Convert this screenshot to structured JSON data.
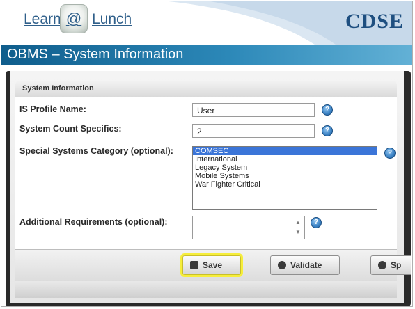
{
  "header": {
    "logo_left": "Learn",
    "logo_at": "@",
    "logo_right": "Lunch",
    "brand": "CDSE",
    "slide_title": "OBMS – System Information"
  },
  "panel": {
    "section_title": "System Information",
    "fields": {
      "profile_name_label": "IS Profile Name:",
      "profile_name_value": "User",
      "count_label": "System Count Specifics:",
      "count_value": "2",
      "category_label": "Special Systems Category (optional):",
      "category_options": [
        "COMSEC",
        "International",
        "Legacy System",
        "Mobile Systems",
        "War Fighter Critical"
      ],
      "category_selected": "COMSEC",
      "additional_label": "Additional Requirements (optional):",
      "additional_value": ""
    },
    "buttons": {
      "save": "Save",
      "validate": "Validate",
      "spell": "Sp"
    }
  },
  "colors": {
    "title_bar_start": "#0f5d8c",
    "title_bar_end": "#63b1d6",
    "selection": "#3b75d8",
    "highlight": "#f6ee3b",
    "brand": "#1e4f80"
  },
  "icons": [
    "help-icon",
    "save-icon",
    "info-icon",
    "check-icon"
  ]
}
